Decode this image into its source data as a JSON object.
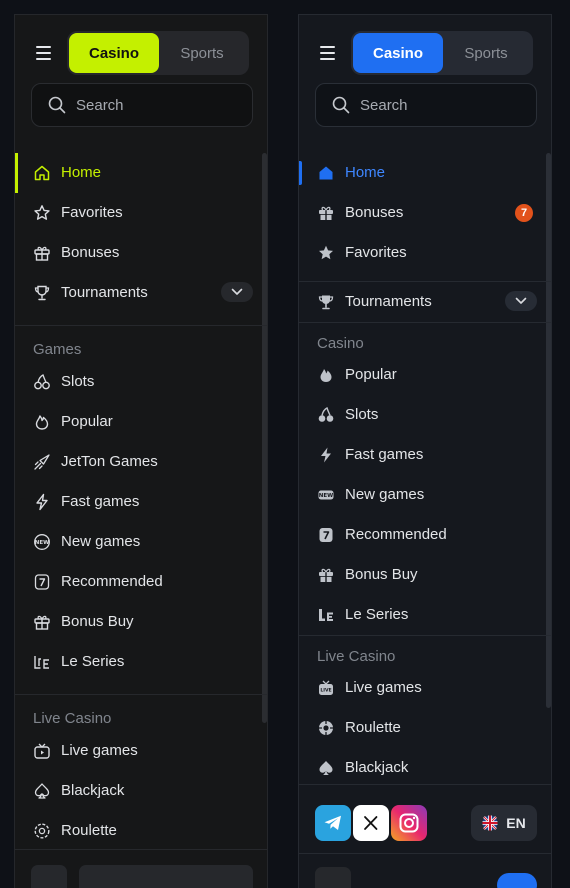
{
  "colors": {
    "left_accent": "#c4f000",
    "right_accent": "#1f6ff2",
    "badge": "#e2521b",
    "background": "#0e1117"
  },
  "left": {
    "tabs": [
      "Casino",
      "Sports"
    ],
    "search_placeholder": "Search",
    "nav": [
      {
        "label": "Home",
        "icon": "home-icon",
        "active": true
      },
      {
        "label": "Favorites",
        "icon": "star-icon"
      },
      {
        "label": "Bonuses",
        "icon": "gift-icon"
      },
      {
        "label": "Tournaments",
        "icon": "trophy-icon",
        "expandable": true
      }
    ],
    "games_section": "Games",
    "games": [
      {
        "label": "Slots",
        "icon": "cherries-icon"
      },
      {
        "label": "Popular",
        "icon": "flame-icon"
      },
      {
        "label": "JetTon Games",
        "icon": "rocket-icon"
      },
      {
        "label": "Fast games",
        "icon": "lightning-icon"
      },
      {
        "label": "New games",
        "icon": "new-icon"
      },
      {
        "label": "Recommended",
        "icon": "seven-icon"
      },
      {
        "label": "Bonus Buy",
        "icon": "gift-icon"
      },
      {
        "label": "Le Series",
        "icon": "le-series-icon"
      }
    ],
    "live_section": "Live Casino",
    "live": [
      {
        "label": "Live games",
        "icon": "tv-icon"
      },
      {
        "label": "Blackjack",
        "icon": "spade-icon"
      },
      {
        "label": "Roulette",
        "icon": "roulette-icon"
      }
    ]
  },
  "right": {
    "tabs": [
      "Casino",
      "Sports"
    ],
    "search_placeholder": "Search",
    "nav": [
      {
        "label": "Home",
        "icon": "home-icon",
        "active": true
      },
      {
        "label": "Bonuses",
        "icon": "gift-icon",
        "badge": "7"
      },
      {
        "label": "Favorites",
        "icon": "star-icon"
      }
    ],
    "tournaments": "Tournaments",
    "casino_section": "Casino",
    "casino": [
      {
        "label": "Popular",
        "icon": "flame-icon"
      },
      {
        "label": "Slots",
        "icon": "cherries-icon"
      },
      {
        "label": "Fast games",
        "icon": "lightning-icon"
      },
      {
        "label": "New games",
        "icon": "new-icon"
      },
      {
        "label": "Recommended",
        "icon": "seven-icon"
      },
      {
        "label": "Bonus Buy",
        "icon": "gift-icon"
      },
      {
        "label": "Le Series",
        "icon": "le-series-icon"
      }
    ],
    "live_section": "Live Casino",
    "live": [
      {
        "label": "Live games",
        "icon": "tv-icon"
      },
      {
        "label": "Roulette",
        "icon": "roulette-icon"
      },
      {
        "label": "Blackjack",
        "icon": "spade-icon"
      }
    ],
    "socials": [
      "telegram-icon",
      "x-icon",
      "instagram-icon"
    ],
    "language": "EN"
  }
}
